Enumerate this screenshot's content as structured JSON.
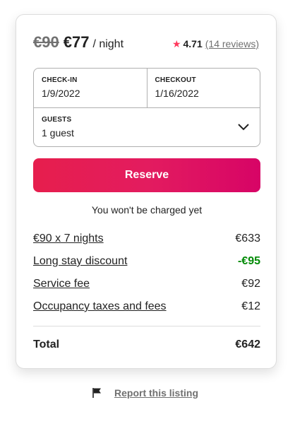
{
  "price": {
    "original": "€90",
    "current": "€77",
    "unit": "/ night"
  },
  "rating": {
    "icon": "star-icon",
    "value": "4.71",
    "reviews_label": "(14 reviews)",
    "star_color": "#ff385c"
  },
  "booking": {
    "checkin_label": "CHECK-IN",
    "checkin_value": "1/9/2022",
    "checkout_label": "CHECKOUT",
    "checkout_value": "1/16/2022",
    "guests_label": "GUESTS",
    "guests_value": "1 guest"
  },
  "reserve": {
    "label": "Reserve",
    "color": "#e31c5f"
  },
  "notice": "You won't be charged yet",
  "breakdown": [
    {
      "label": "€90 x 7 nights",
      "amount": "€633"
    },
    {
      "label": "Long stay discount",
      "amount": "-€95"
    },
    {
      "label": "Service fee",
      "amount": "€92"
    },
    {
      "label": "Occupancy taxes and fees",
      "amount": "€12"
    }
  ],
  "total": {
    "label": "Total",
    "amount": "€642"
  },
  "report": {
    "icon": "flag-icon",
    "label": "Report this listing"
  }
}
